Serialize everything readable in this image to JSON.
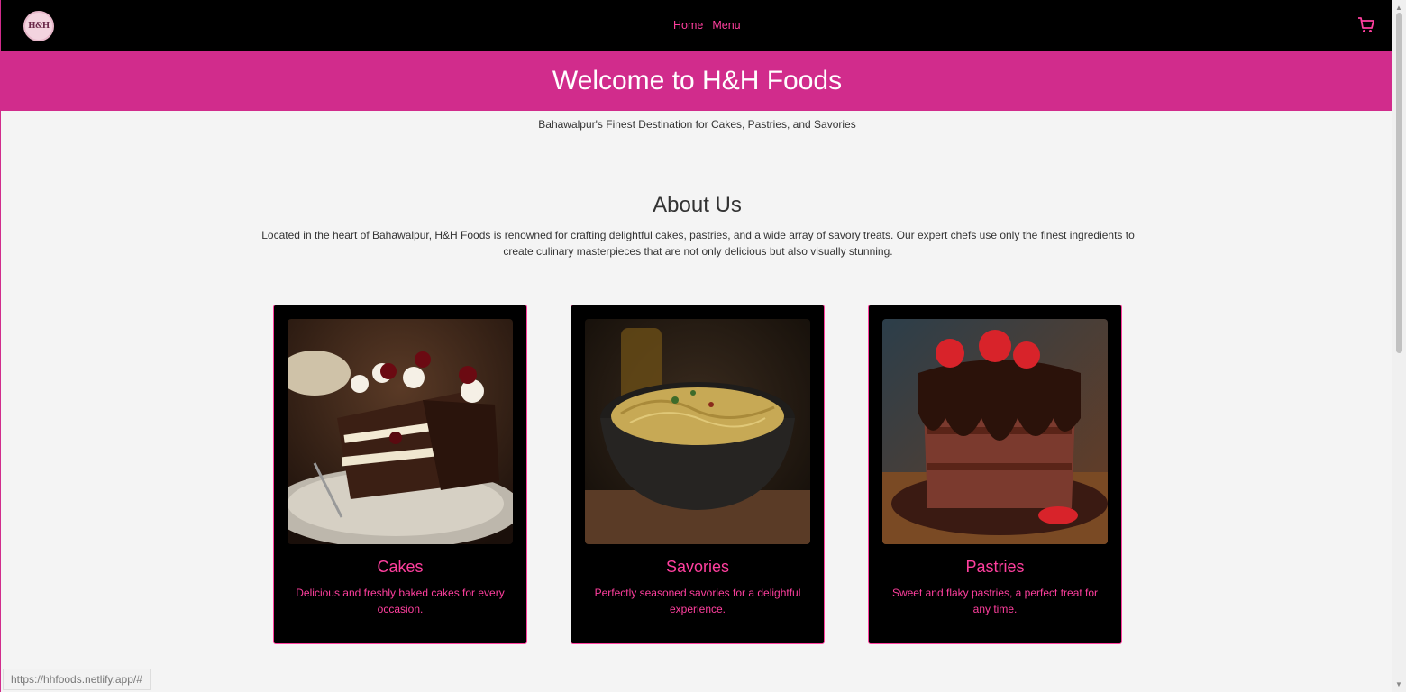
{
  "nav": {
    "logo_text": "H&H",
    "links": [
      "Home",
      "Menu"
    ],
    "cart_icon": "cart-icon"
  },
  "hero": {
    "title": "Welcome to H&H Foods",
    "tagline": "Bahawalpur's Finest Destination for Cakes, Pastries, and Savories"
  },
  "about": {
    "title": "About Us",
    "text": "Located in the heart of Bahawalpur, H&H Foods is renowned for crafting delightful cakes, pastries, and a wide array of savory treats. Our expert chefs use only the finest ingredients to create culinary masterpieces that are not only delicious but also visually stunning."
  },
  "cards": [
    {
      "title": "Cakes",
      "desc": "Delicious and freshly baked cakes for every occasion."
    },
    {
      "title": "Savories",
      "desc": "Perfectly seasoned savories for a delightful experience."
    },
    {
      "title": "Pastries",
      "desc": "Sweet and flaky pastries, a perfect treat for any time."
    }
  ],
  "status_bar": {
    "url": "https://hhfoods.netlify.app/#"
  },
  "colors": {
    "brand_pink": "#d12c8c",
    "accent_pink": "#ff3f9e",
    "nav_bg": "#000000",
    "page_bg": "#f4f4f4"
  }
}
